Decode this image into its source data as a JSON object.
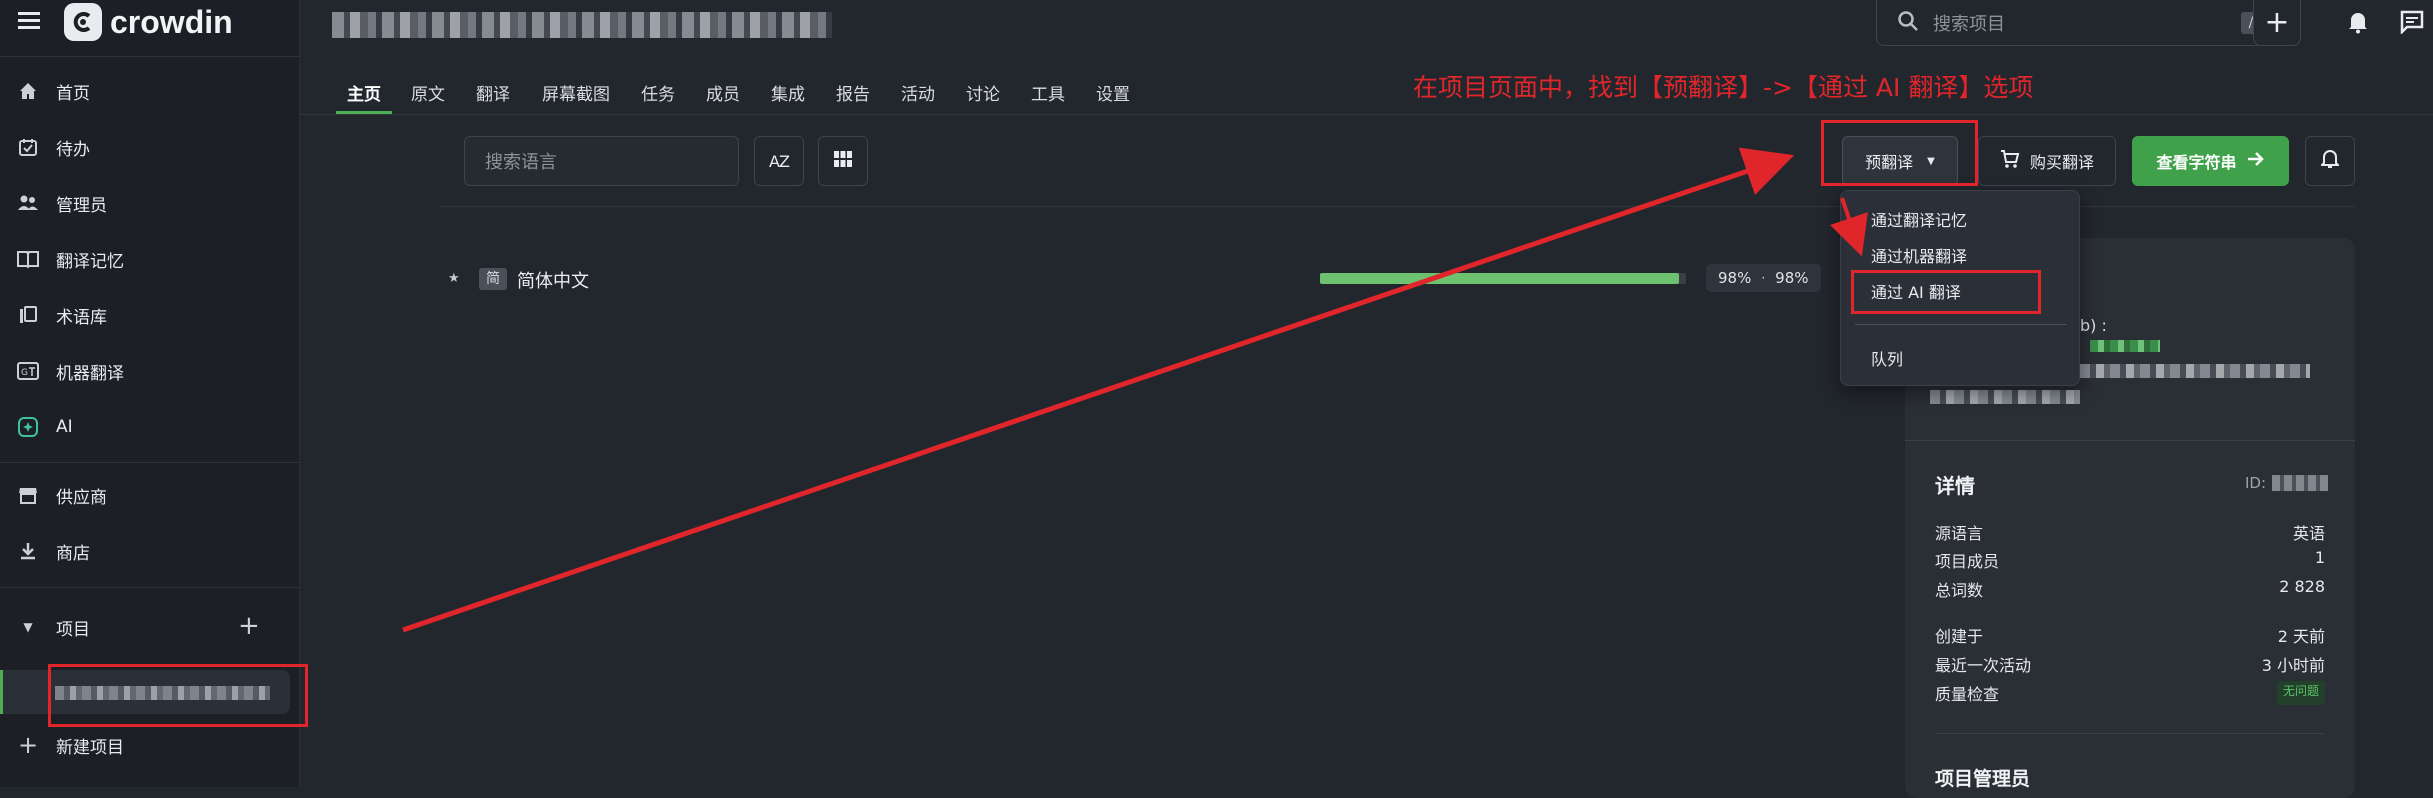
{
  "brand": {
    "name": "crowdin"
  },
  "sidebar": {
    "items": [
      {
        "label": "首页",
        "icon": "home-icon"
      },
      {
        "label": "待办",
        "icon": "calendar-check-icon"
      },
      {
        "label": "管理员",
        "icon": "people-icon"
      },
      {
        "label": "翻译记忆",
        "icon": "book-icon"
      },
      {
        "label": "术语库",
        "icon": "library-icon"
      },
      {
        "label": "机器翻译",
        "icon": "machine-translate-icon"
      },
      {
        "label": "AI",
        "icon": "ai-icon"
      },
      {
        "label": "供应商",
        "icon": "store-icon"
      },
      {
        "label": "商店",
        "icon": "download-icon"
      }
    ],
    "projects_label": "项目",
    "new_project_label": "新建项目"
  },
  "header": {
    "search_placeholder": "搜索项目",
    "search_shortcut": "/",
    "tabs": [
      "主页",
      "原文",
      "翻译",
      "屏幕截图",
      "任务",
      "成员",
      "集成",
      "报告",
      "活动",
      "讨论",
      "工具",
      "设置"
    ],
    "annotation": "在项目页面中，找到【预翻译】->【通过 AI 翻译】选项"
  },
  "toolbar": {
    "search_language_placeholder": "搜索语言",
    "sort_label": "AZ",
    "pretranslate_label": "预翻译",
    "buy_translation_label": "购买翻译",
    "view_strings_label": "查看字符串"
  },
  "dropdown": {
    "items": [
      "通过翻译记忆",
      "通过机器翻译",
      "通过 AI 翻译",
      "队列"
    ]
  },
  "languages": [
    {
      "badge": "简",
      "name": "简体中文",
      "progress": 98,
      "progress_text": "98%",
      "approved_text": "98%",
      "separator": "·"
    }
  ],
  "details": {
    "partial_label": "b) :",
    "title": "详情",
    "id_label": "ID:",
    "rows": [
      {
        "label": "源语言",
        "value": "英语"
      },
      {
        "label": "项目成员",
        "value": "1"
      },
      {
        "label": "总词数",
        "value": "2 828"
      },
      {
        "label": "创建于",
        "value": "2 天前"
      },
      {
        "label": "最近一次活动",
        "value": "3 小时前"
      },
      {
        "label": "质量检查",
        "value": "无问题"
      }
    ],
    "managers_title": "项目管理员"
  },
  "colors": {
    "accent_green": "#3fa14a",
    "annotation_red": "#e0262b",
    "background": "#22262d",
    "sidebar": "#1c1f25"
  }
}
